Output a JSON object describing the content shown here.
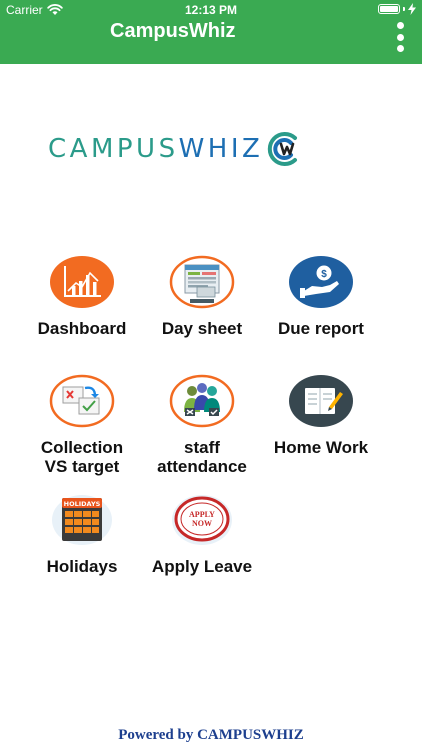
{
  "status_bar": {
    "carrier": "Carrier",
    "time": "12:13 PM"
  },
  "app_bar": {
    "title": "CampusWhiz",
    "color": "#3aaa52"
  },
  "logo": {
    "text_part1": "CAMPUS",
    "text_part2": "WHIZ"
  },
  "menu": [
    {
      "label": "Dashboard",
      "icon": "dashboard-chart-icon"
    },
    {
      "label": "Day sheet",
      "icon": "day-sheet-icon"
    },
    {
      "label": "Due report",
      "icon": "due-report-hand-coin-icon"
    },
    {
      "label": "Collection VS target",
      "label_line1": "Collection",
      "label_line2": "VS target",
      "icon": "collection-vs-target-icon"
    },
    {
      "label": "staff attendance",
      "label_line1": "staff",
      "label_line2": "attendance",
      "icon": "staff-attendance-icon"
    },
    {
      "label": "Home Work",
      "icon": "homework-book-icon"
    },
    {
      "label": "Holidays",
      "icon": "holidays-calendar-icon"
    },
    {
      "label": "Apply Leave",
      "icon": "apply-now-stamp-icon"
    }
  ],
  "footer": {
    "text": "Powered by CAMPUSWHIZ"
  }
}
